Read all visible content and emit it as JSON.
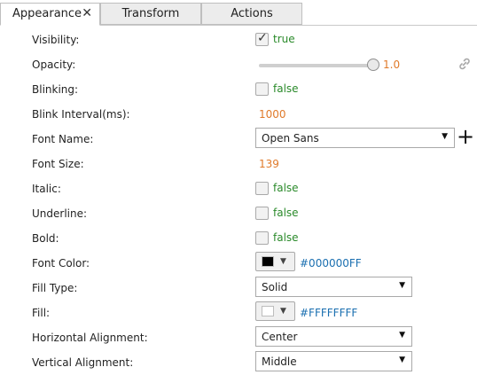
{
  "tabs": [
    {
      "label": "Appearance",
      "active": true,
      "close_glyph": "✕"
    },
    {
      "label": "Transform",
      "active": false
    },
    {
      "label": "Actions",
      "active": false
    }
  ],
  "properties": {
    "visibility": {
      "label": "Visibility:",
      "checked": true,
      "value": "true"
    },
    "opacity": {
      "label": "Opacity:",
      "value": "1.0",
      "level": 1.0,
      "link_icon": "link-icon"
    },
    "blinking": {
      "label": "Blinking:",
      "checked": false,
      "value": "false"
    },
    "blink_interval": {
      "label": "Blink Interval(ms):",
      "value": "1000"
    },
    "font_name": {
      "label": "Font Name:",
      "value": "Open Sans",
      "add_icon": "plus-icon"
    },
    "font_size": {
      "label": "Font Size:",
      "value": "139"
    },
    "italic": {
      "label": "Italic:",
      "checked": false,
      "value": "false"
    },
    "underline": {
      "label": "Underline:",
      "checked": false,
      "value": "false"
    },
    "bold": {
      "label": "Bold:",
      "checked": false,
      "value": "false"
    },
    "font_color": {
      "label": "Font Color:",
      "value": "#000000FF",
      "swatch": "#000000"
    },
    "fill_type": {
      "label": "Fill Type:",
      "value": "Solid"
    },
    "fill": {
      "label": "Fill:",
      "value": "#FFFFFFFF",
      "swatch": "#ffffff"
    },
    "horizontal_alignment": {
      "label": "Horizontal Alignment:",
      "value": "Center"
    },
    "vertical_alignment": {
      "label": "Vertical Alignment:",
      "value": "Middle"
    }
  },
  "glyphs": {
    "checkmark": "✓",
    "dropdown_arrow": "▼",
    "plus": "+"
  },
  "colors": {
    "true_value": "#2a8a2a",
    "number_value": "#e07a2a",
    "hex_value": "#1a6fb0"
  }
}
